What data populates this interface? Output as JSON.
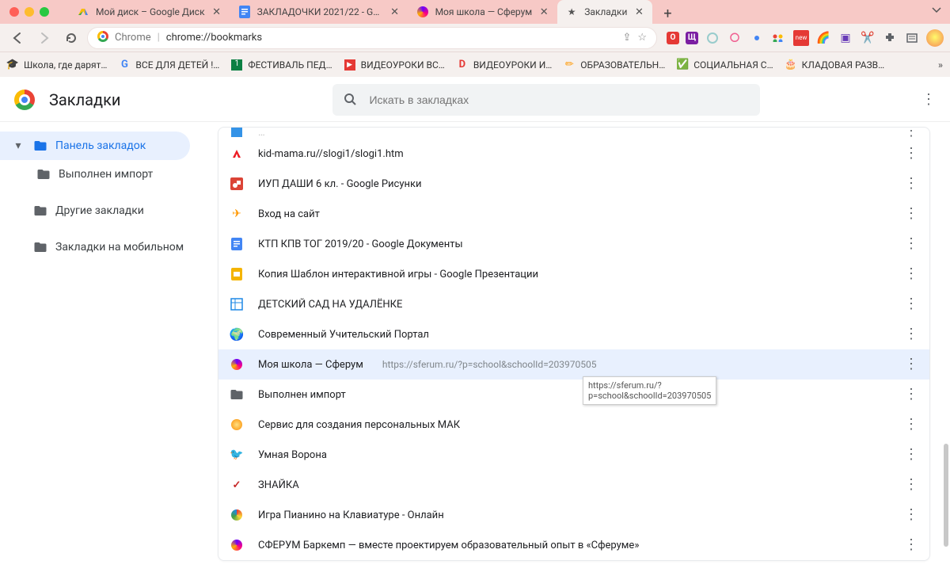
{
  "window": {
    "tabs": [
      {
        "favicon": "gdrive",
        "label": "Мой диск – Google Диск",
        "active": false
      },
      {
        "favicon": "gdocs",
        "label": "ЗАКЛАДОЧКИ 2021/22 - Goo…",
        "active": false
      },
      {
        "favicon": "sferum",
        "label": "Моя школа — Сферум",
        "active": false
      },
      {
        "favicon": "star",
        "label": "Закладки",
        "active": true
      }
    ]
  },
  "toolbar": {
    "omnibox_prefix": "Chrome",
    "omnibox_url": "chrome://bookmarks"
  },
  "bookmarks_bar": {
    "items": [
      {
        "icon": "🎓",
        "label": "Школа, где дарят…"
      },
      {
        "icon": "G",
        "label": "ВСЕ ДЛЯ ДЕТЕЙ !…"
      },
      {
        "icon": "🟩",
        "label": "ФЕСТИВАЛЬ ПЕД…"
      },
      {
        "icon": "▶",
        "label": "ВИДЕОУРОКИ ВС…"
      },
      {
        "icon": "D",
        "label": "ВИДЕОУРОКИ И…"
      },
      {
        "icon": "✏",
        "label": "ОБРАЗОВАТЕЛЬН…"
      },
      {
        "icon": "✅",
        "label": "СОЦИАЛЬНАЯ С…"
      },
      {
        "icon": "🎂",
        "label": "КЛАДОВАЯ РАЗВ…"
      }
    ]
  },
  "page": {
    "title": "Закладки",
    "search_placeholder": "Искать в закладках",
    "sidebar": [
      {
        "label": "Панель закладок",
        "selected": true,
        "expandable": true
      },
      {
        "label": "Выполнен импорт",
        "child": true
      },
      {
        "label": "Другие закладки"
      },
      {
        "label": "Закладки на мобильном"
      }
    ],
    "rows": [
      {
        "favicon": "adobe",
        "title": "kid-mama.ru//slogi1/slogi1.htm"
      },
      {
        "favicon": "gdraw",
        "title": "ИУП ДАШИ 6 кл. - Google Рисунки"
      },
      {
        "favicon": "plane",
        "title": "Вход на сайт"
      },
      {
        "favicon": "gdocs",
        "title": "КТП КПВ ТОГ 2019/20 - Google Документы"
      },
      {
        "favicon": "gslides",
        "title": "Копия Шаблон интерактивной игры - Google Презентации"
      },
      {
        "favicon": "grid",
        "title": "ДЕТСКИЙ САД НА УДАЛЁНКЕ"
      },
      {
        "favicon": "globe",
        "title": "Современный Учительский Портал"
      },
      {
        "favicon": "sferum",
        "title": "Моя школа — Сферум",
        "url": "https://sferum.ru/?p=school&schoolId=203970505",
        "hover": true,
        "tooltip": "https://sferum.ru/?\np=school&schoolId=203970505"
      },
      {
        "favicon": "folder",
        "title": "Выполнен импорт"
      },
      {
        "favicon": "coin",
        "title": "Сервис для создания персональных МАК"
      },
      {
        "favicon": "crow",
        "title": "Умная Ворона"
      },
      {
        "favicon": "check",
        "title": "ЗНАЙКА"
      },
      {
        "favicon": "ball",
        "title": "Игра Пианино на Клавиатуре - Онлайн"
      },
      {
        "favicon": "sferum",
        "title": "СФЕРУМ Баркемп — вместе проектируем образовательный опыт в «Сферуме»"
      }
    ]
  }
}
